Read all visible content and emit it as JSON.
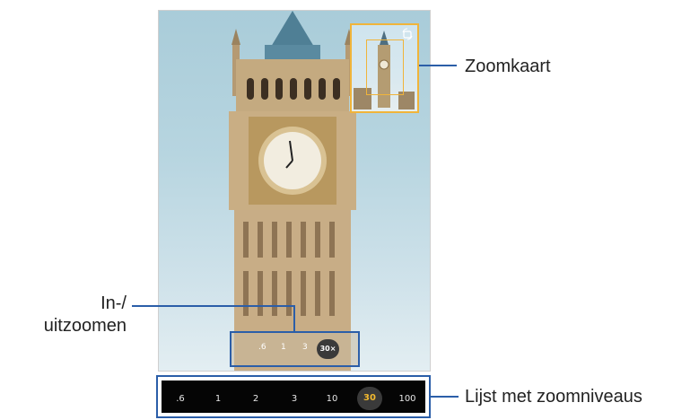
{
  "callouts": {
    "map_label": "Zoomkaart",
    "zoom_label_line1": "In-/",
    "zoom_label_line2": "uitzoomen",
    "list_label": "Lijst met zoomniveaus"
  },
  "zoom_bar": {
    "items": [
      ".6",
      "1",
      "3"
    ],
    "active": "30×"
  },
  "zoom_list": {
    "items": [
      ".6",
      "1",
      "2",
      "3",
      "10"
    ],
    "active": "30",
    "after_active": "100",
    "active_color": "#f2b92f"
  },
  "icons": [
    "rotate-camera-icon"
  ]
}
